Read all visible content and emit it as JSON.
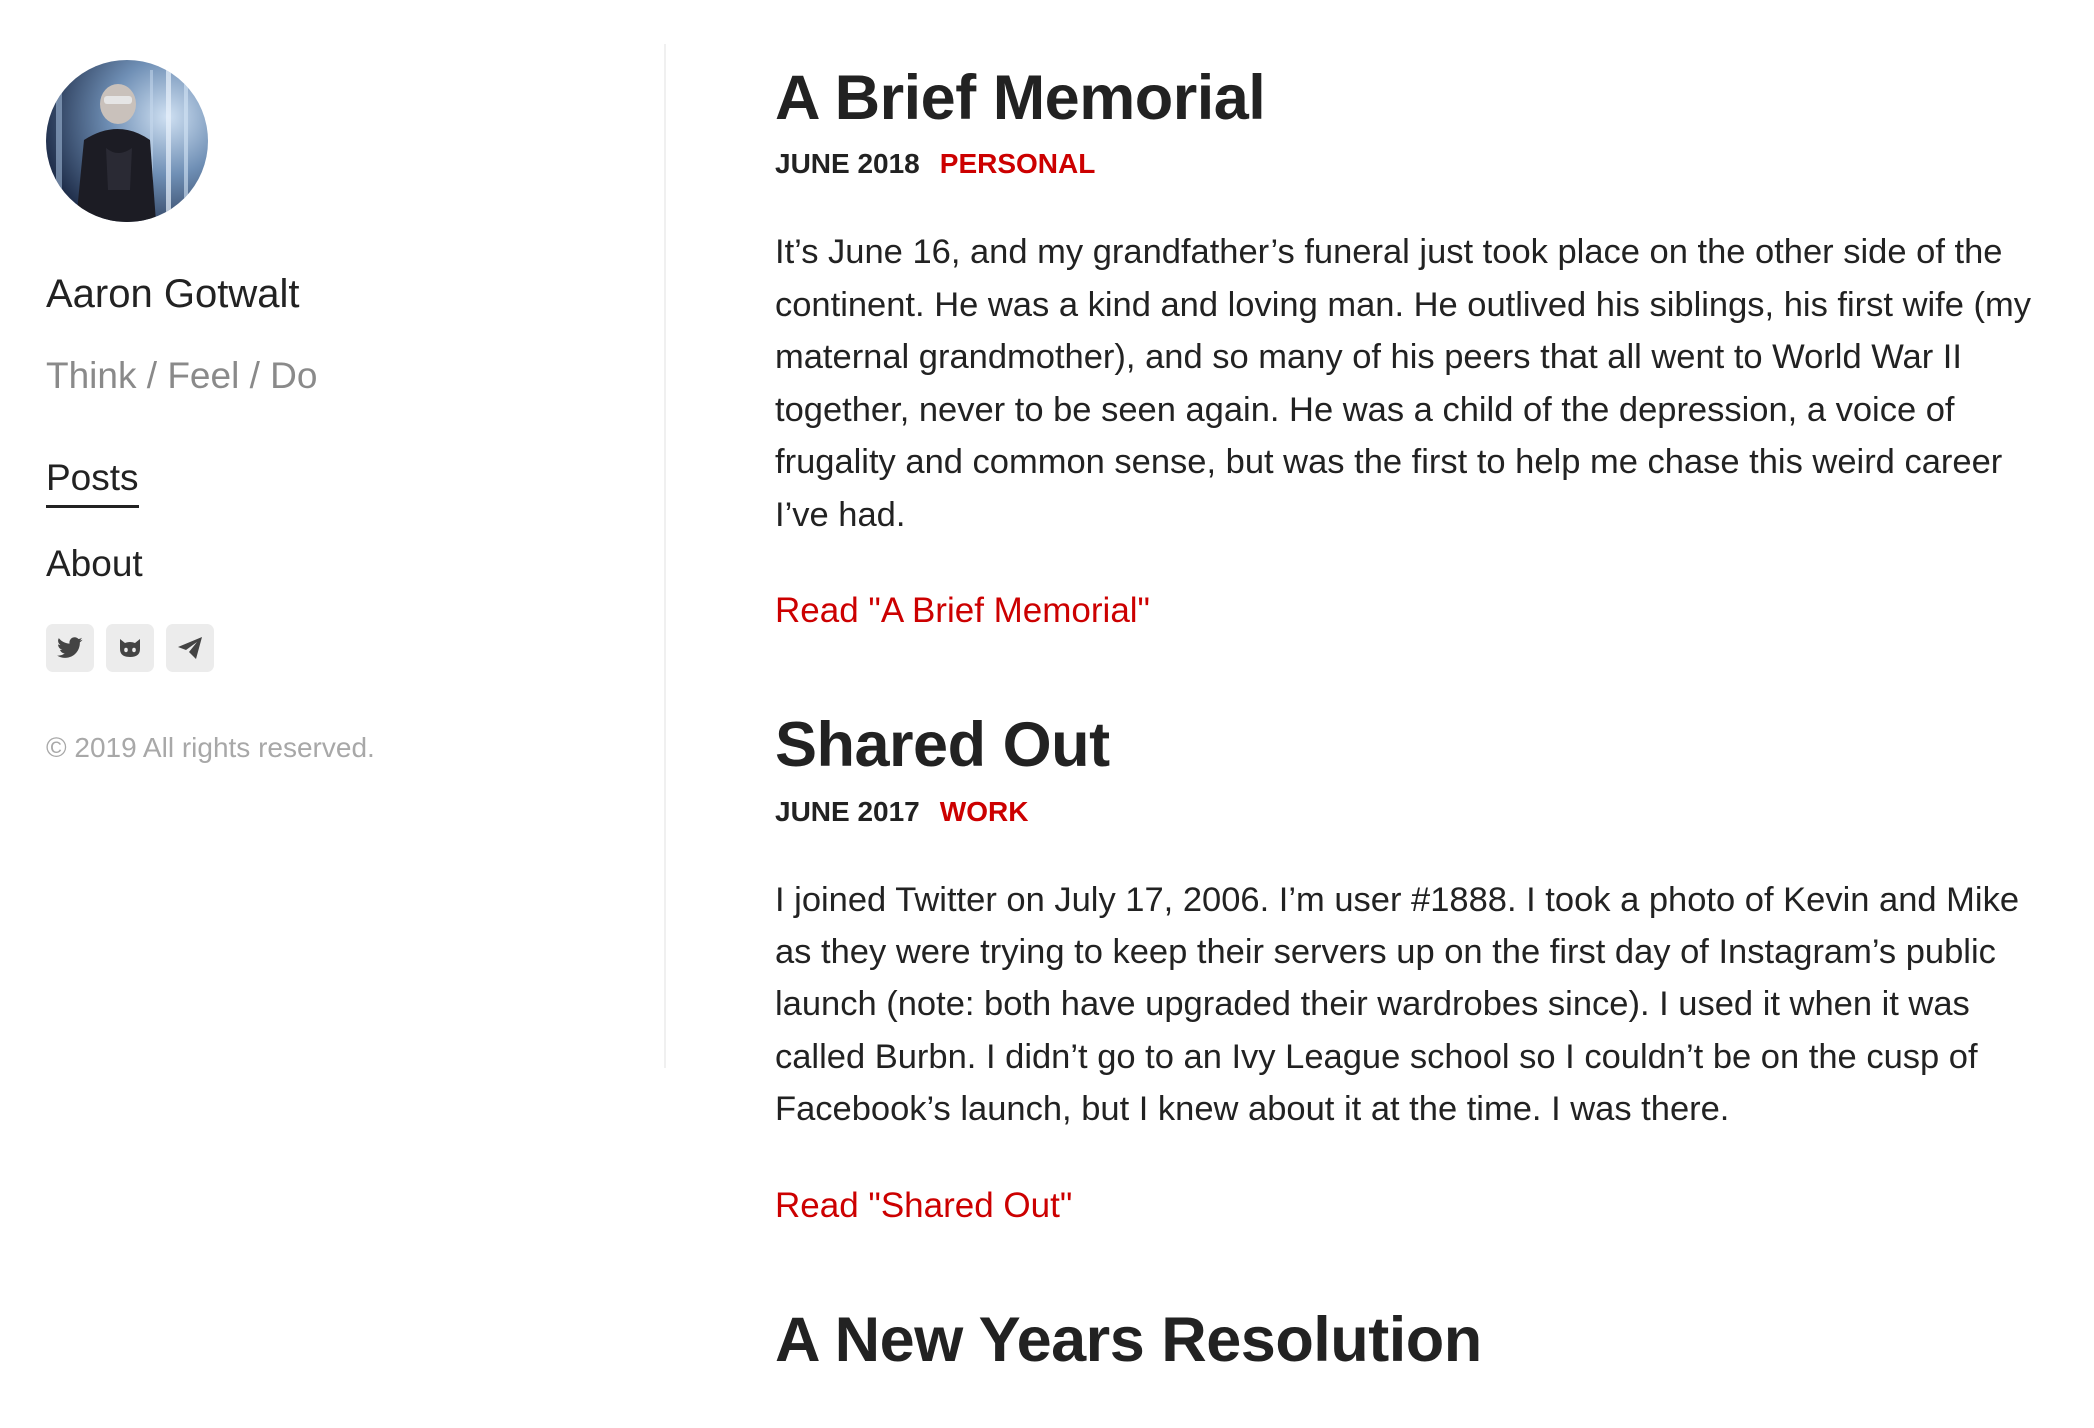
{
  "sidebar": {
    "name": "Aaron Gotwalt",
    "tagline": "Think / Feel / Do",
    "nav": [
      {
        "label": "Posts",
        "active": true
      },
      {
        "label": "About",
        "active": false
      }
    ],
    "social_icons": [
      "twitter-icon",
      "github-icon",
      "telegram-icon"
    ],
    "copyright": "© 2019 All rights reserved."
  },
  "posts": [
    {
      "title": "A Brief Memorial",
      "date": "JUNE 2018",
      "category": "PERSONAL",
      "excerpt": "It’s June 16, and my grandfather’s funeral just took place on the other side of the continent. He was a kind and loving man. He outlived his siblings, his first wife (my maternal grandmother), and so many of his peers that all went to World War II together, never to be seen again. He was a child of the depression, a voice of frugality and common sense, but was the first to help me chase this weird career I’ve had.",
      "read_more": "Read \"A Brief Memorial\""
    },
    {
      "title": "Shared Out",
      "date": "JUNE 2017",
      "category": "WORK",
      "excerpt": "I joined Twitter on July 17, 2006. I’m user #1888. I took a photo of Kevin and Mike as they were trying to keep their servers up on the first day of Instagram’s public launch (note: both have upgraded their wardrobes since). I used it when it was called Burbn. I didn’t go to an Ivy League school so I couldn’t be on the cusp of Facebook’s launch, but I knew about it at the time. I was there.",
      "read_more": "Read \"Shared Out\""
    },
    {
      "title": "A New Years Resolution"
    }
  ],
  "colors": {
    "accent": "#cc0000",
    "text": "#222222",
    "muted": "#8a8a8a"
  }
}
